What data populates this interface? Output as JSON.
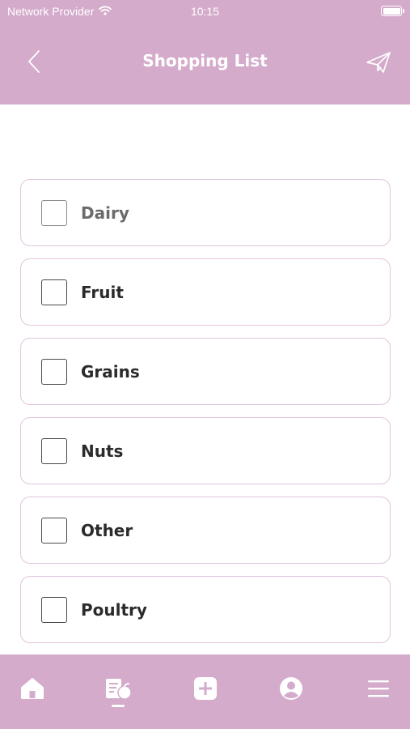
{
  "status_bar": {
    "carrier": "Network Provider",
    "time": "10:15",
    "wifi_icon": "wifi-icon",
    "battery_icon": "battery-icon"
  },
  "header": {
    "title": "Shopping List",
    "back_icon": "chevron-left-icon",
    "send_icon": "paper-plane-icon"
  },
  "items": [
    {
      "label": "Dairy",
      "checked": false
    },
    {
      "label": "Fruit",
      "checked": false
    },
    {
      "label": "Grains",
      "checked": false
    },
    {
      "label": "Nuts",
      "checked": false
    },
    {
      "label": "Other",
      "checked": false
    },
    {
      "label": "Poultry",
      "checked": false
    }
  ],
  "bottom_nav": {
    "items": [
      "home-icon",
      "grocery-list-icon",
      "add-icon",
      "profile-icon",
      "menu-icon"
    ],
    "active": "grocery-list-icon"
  },
  "colors": {
    "accent": "#d4abcb",
    "card_border": "#e3c4dc",
    "text": "#2b2b2b"
  }
}
